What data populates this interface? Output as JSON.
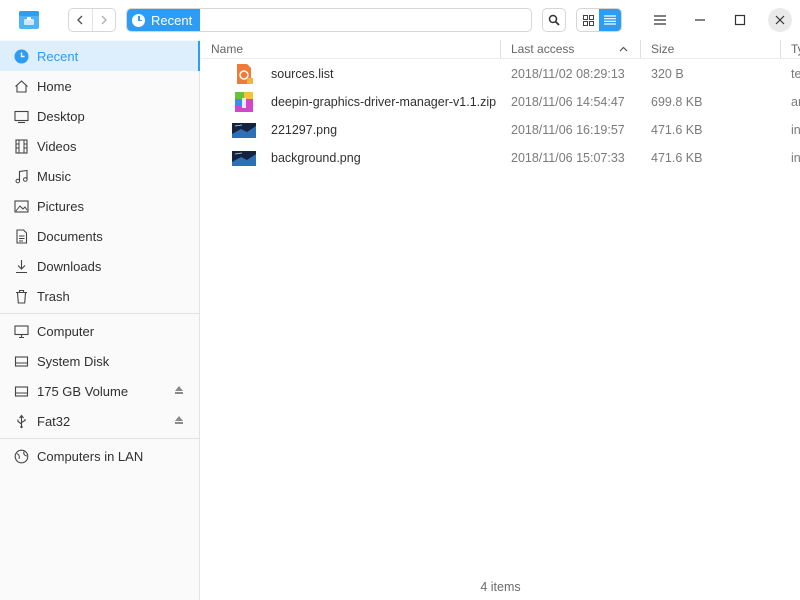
{
  "titlebar": {
    "breadcrumb_label": "Recent"
  },
  "sidebar": {
    "items": [
      {
        "label": "Recent",
        "icon": "clock-icon",
        "active": true
      },
      {
        "label": "Home",
        "icon": "home-icon"
      },
      {
        "label": "Desktop",
        "icon": "desktop-icon"
      },
      {
        "label": "Videos",
        "icon": "film-icon"
      },
      {
        "label": "Music",
        "icon": "music-note-icon"
      },
      {
        "label": "Pictures",
        "icon": "picture-icon"
      },
      {
        "label": "Documents",
        "icon": "document-icon"
      },
      {
        "label": "Downloads",
        "icon": "download-icon"
      },
      {
        "label": "Trash",
        "icon": "trash-icon"
      },
      {
        "label": "Computer",
        "icon": "computer-icon"
      },
      {
        "label": "System Disk",
        "icon": "disk-icon"
      },
      {
        "label": "175 GB Volume",
        "icon": "disk-icon",
        "ejectable": true
      },
      {
        "label": "Fat32",
        "icon": "usb-icon",
        "ejectable": true
      },
      {
        "label": "Computers in LAN",
        "icon": "network-icon"
      }
    ]
  },
  "table": {
    "columns": [
      "Name",
      "Last access",
      "Size",
      "Ty"
    ],
    "sorted_column": "Last access",
    "rows": [
      {
        "name": "sources.list",
        "last_access": "2018/11/02 08:29:13",
        "size": "320 B",
        "type": "te",
        "icon": "text-file-icon"
      },
      {
        "name": "deepin-graphics-driver-manager-v1.1.zip",
        "last_access": "2018/11/06 14:54:47",
        "size": "699.8 KB",
        "type": "ar",
        "icon": "zip-archive-icon"
      },
      {
        "name": "221297.png",
        "last_access": "2018/11/06 16:19:57",
        "size": "471.6 KB",
        "type": "in",
        "icon": "image-thumbnail-icon"
      },
      {
        "name": "background.png",
        "last_access": "2018/11/06 15:07:33",
        "size": "471.6 KB",
        "type": "in",
        "icon": "image-thumbnail-icon"
      }
    ]
  },
  "status_bar": {
    "text": "4 items"
  },
  "colors": {
    "accent": "#2c9cf4",
    "sidebar_active_bg": "#ddeefc"
  }
}
